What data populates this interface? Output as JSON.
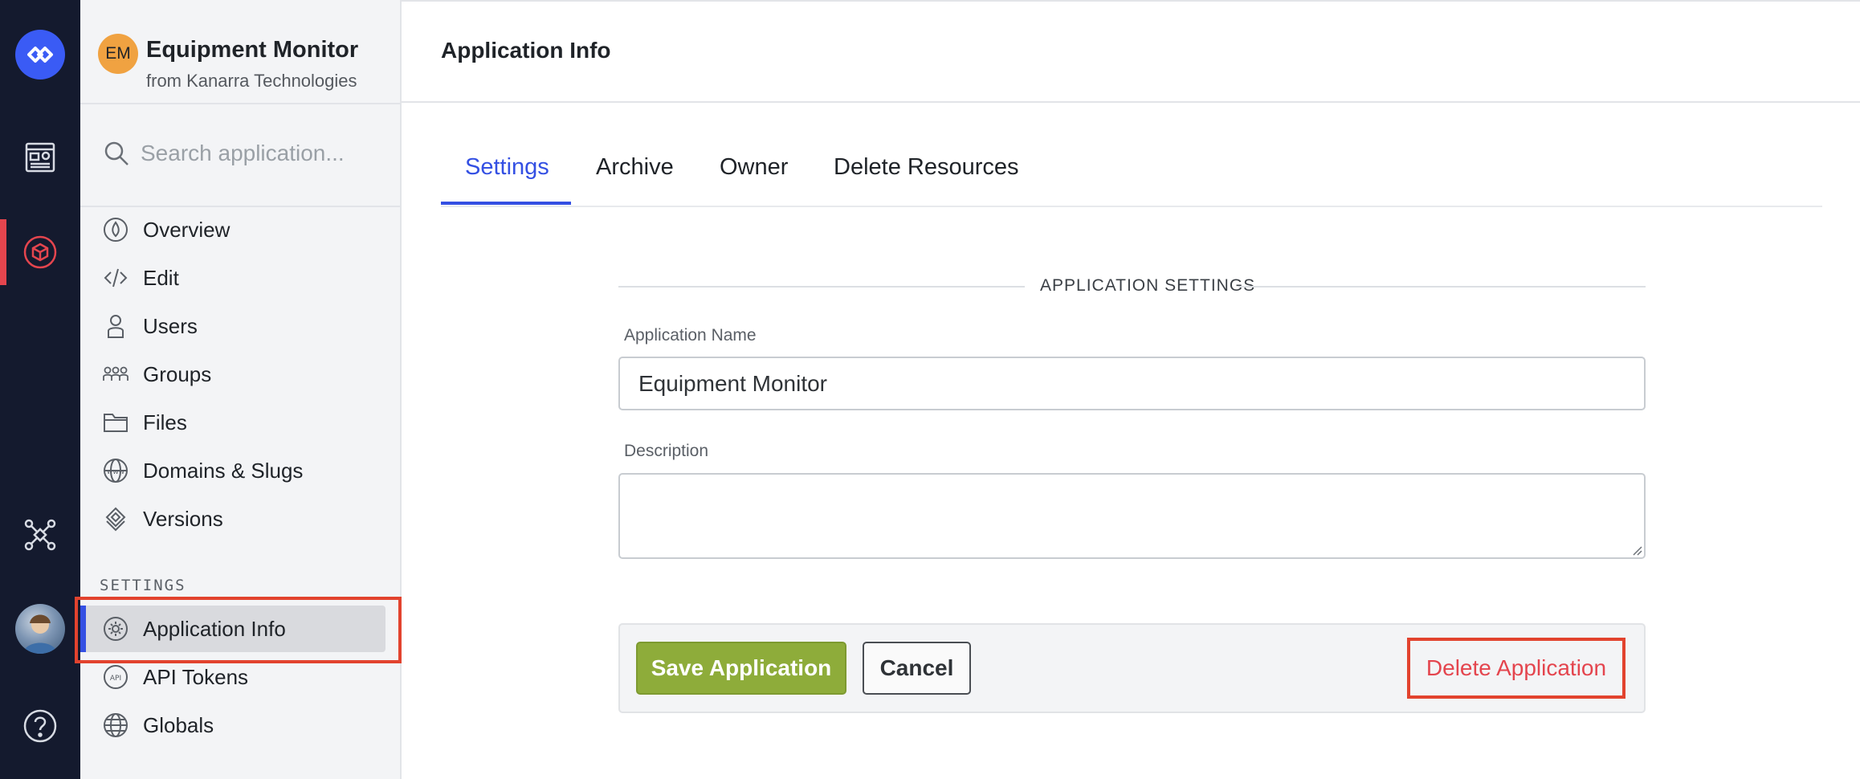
{
  "colors": {
    "rail_bg": "#141a2e",
    "accent_blue": "#3450e3",
    "rail_active": "#e4454e",
    "save_green": "#8eac3a",
    "delete_red": "#e4454e",
    "highlight_red": "#e2432e"
  },
  "rail": {
    "icons": [
      "logo-icon",
      "dashboard-icon",
      "applications-cube-icon",
      "network-icon",
      "user-avatar",
      "help-icon"
    ]
  },
  "app": {
    "badge": "EM",
    "name": "Equipment Monitor",
    "org": "from Kanarra Technologies"
  },
  "search": {
    "placeholder": "Search application..."
  },
  "sidebar": {
    "items": [
      {
        "label": "Overview",
        "icon": "overview-icon"
      },
      {
        "label": "Edit",
        "icon": "edit-code-icon"
      },
      {
        "label": "Users",
        "icon": "user-icon"
      },
      {
        "label": "Groups",
        "icon": "groups-icon"
      },
      {
        "label": "Files",
        "icon": "folder-icon"
      },
      {
        "label": "Domains & Slugs",
        "icon": "www-globe-icon"
      },
      {
        "label": "Versions",
        "icon": "versions-icon"
      }
    ],
    "settings_label": "SETTINGS",
    "settings_items": [
      {
        "label": "Application Info",
        "icon": "gear-icon",
        "active": true
      },
      {
        "label": "API Tokens",
        "icon": "api-icon"
      },
      {
        "label": "Globals",
        "icon": "globe-icon"
      }
    ]
  },
  "header": {
    "title": "Application Info"
  },
  "tabs": [
    {
      "label": "Settings",
      "active": true
    },
    {
      "label": "Archive"
    },
    {
      "label": "Owner"
    },
    {
      "label": "Delete Resources"
    }
  ],
  "form": {
    "section_title": "APPLICATION SETTINGS",
    "name_label": "Application Name",
    "name_value": "Equipment Monitor",
    "description_label": "Description",
    "description_value": ""
  },
  "actions": {
    "save": "Save Application",
    "cancel": "Cancel",
    "delete": "Delete Application"
  }
}
